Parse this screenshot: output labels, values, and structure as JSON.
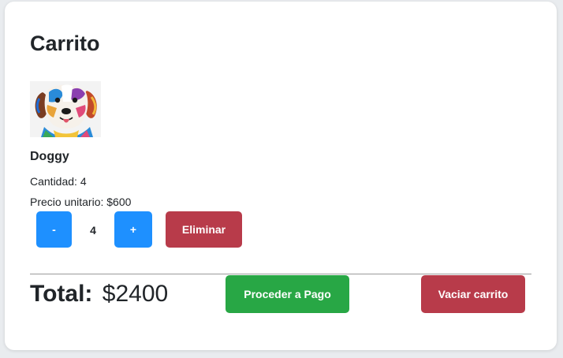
{
  "cart": {
    "title": "Carrito",
    "item": {
      "image_icon": "dog-painting-image",
      "name": "Doggy",
      "quantity_text": "Cantidad: 4",
      "unit_price_text": "Precio unitario: $600",
      "quantity_value": "4",
      "decrease_label": "-",
      "increase_label": "+",
      "remove_label": "Eliminar"
    },
    "total_label": "Total:",
    "total_value": "$2400",
    "checkout_label": "Proceder a Pago",
    "clear_label": "Vaciar carrito"
  },
  "colors": {
    "primary_blue": "#1e90ff",
    "danger_red": "#b83b4a",
    "success_green": "#28a745"
  }
}
